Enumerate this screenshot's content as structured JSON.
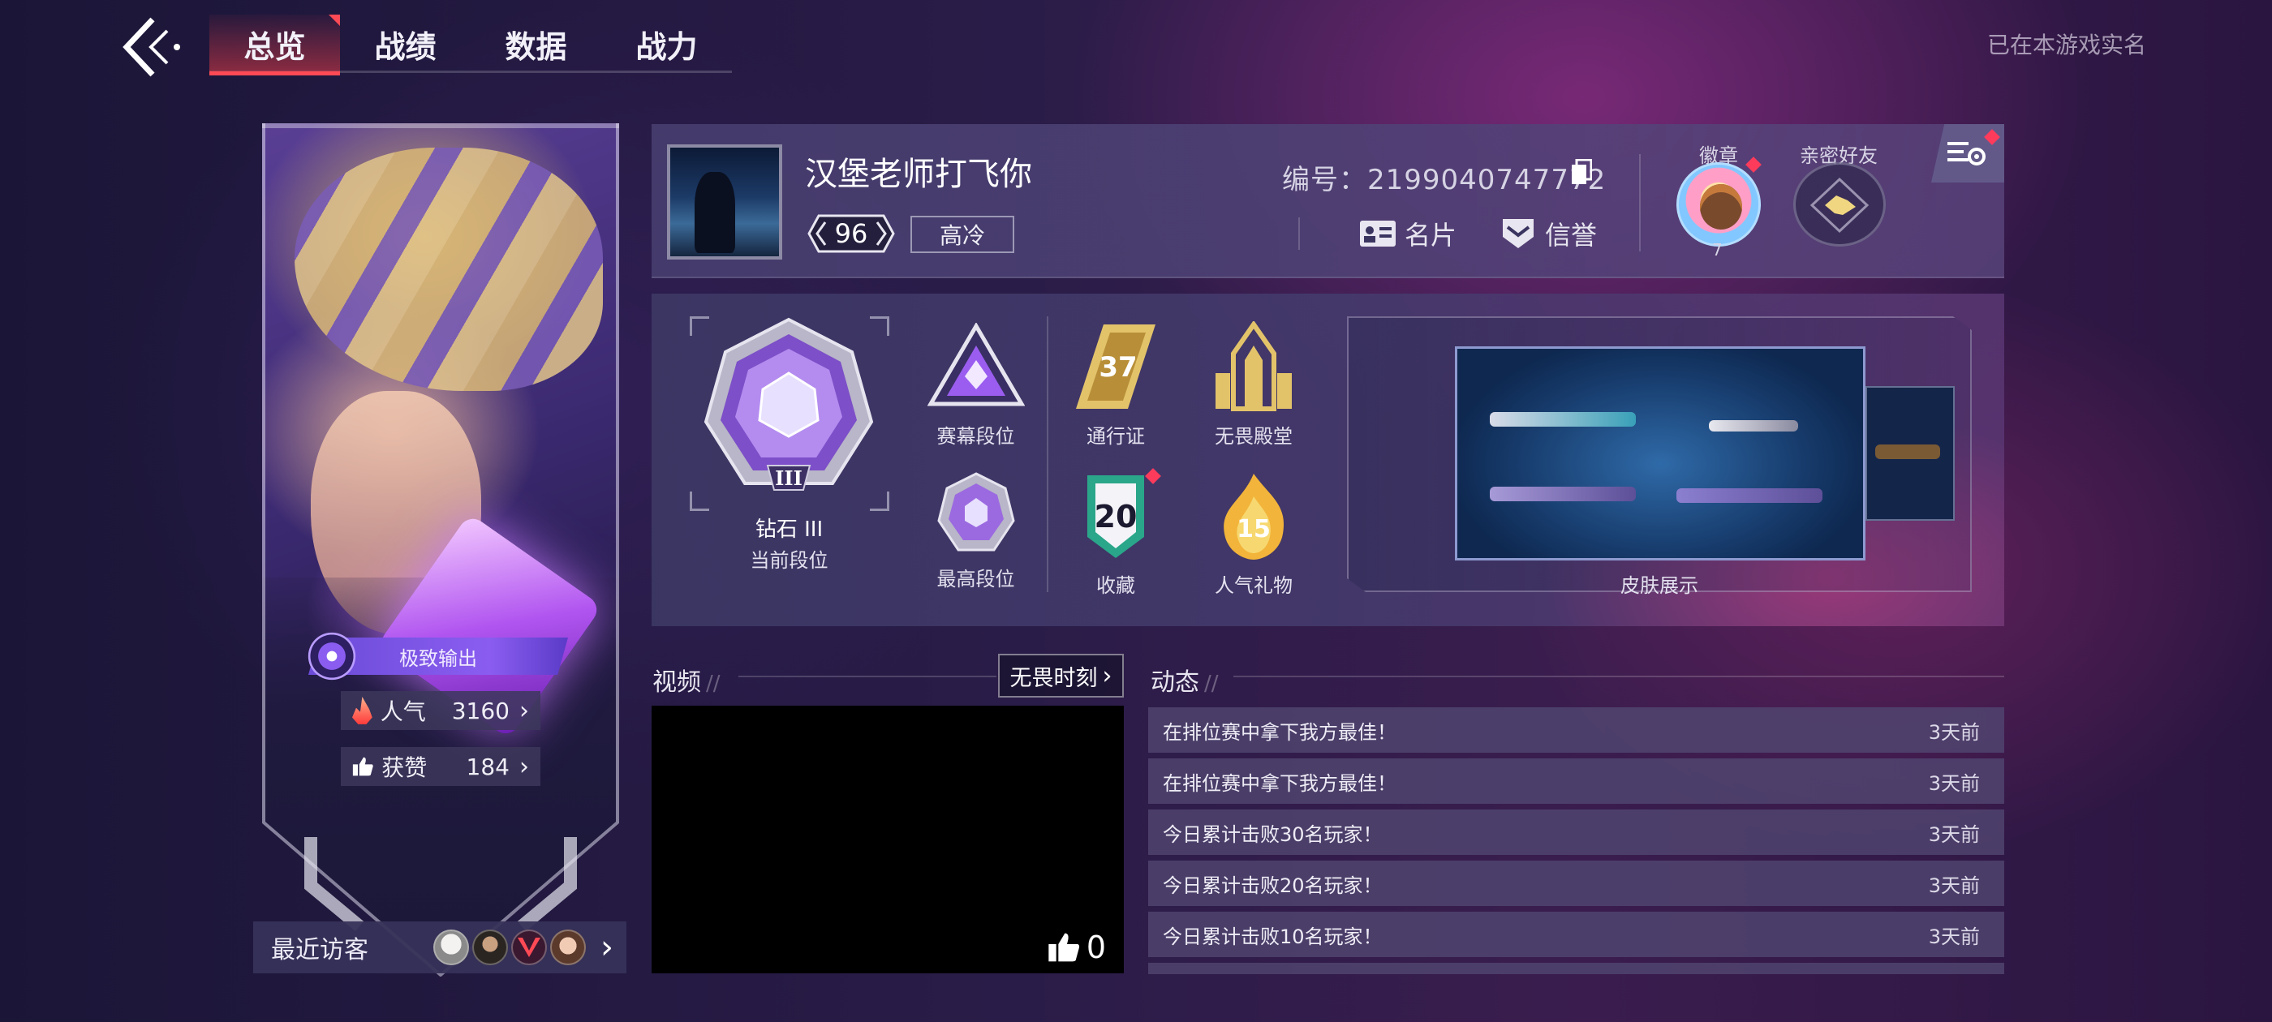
{
  "nav": {
    "tabs": [
      {
        "label": "总览",
        "active": true
      },
      {
        "label": "战绩",
        "active": false
      },
      {
        "label": "数据",
        "active": false
      },
      {
        "label": "战力",
        "active": false
      }
    ],
    "realname_label": "已在本游戏实名"
  },
  "agent_card": {
    "role_label": "极致输出",
    "popularity_label": "人气",
    "popularity_value": "3160",
    "likes_label": "获赞",
    "likes_value": "184",
    "visitors_label": "最近访客"
  },
  "profile": {
    "name": "汉堡老师打飞你",
    "level": "96",
    "title_tag": "高冷",
    "id_text": "编号：2199040747772",
    "card_label": "名片",
    "credit_label": "信誉",
    "badge_label": "徽章",
    "badge_count": "7",
    "friend_label": "亲密好友"
  },
  "rank": {
    "current_rank_name": "钻石 III",
    "current_rank_label": "当前段位",
    "season_rank_label": "赛幕段位",
    "highest_rank_label": "最高段位",
    "battlepass_label": "通行证",
    "battlepass_level": "37",
    "hall_label": "无畏殿堂",
    "collection_label": "收藏",
    "collection_count": "20",
    "gift_label": "人气礼物",
    "gift_count": "15",
    "skin_label": "皮肤展示"
  },
  "video": {
    "section_title": "视频",
    "moment_button": "无畏时刻",
    "likes": "0"
  },
  "feed": {
    "section_title": "动态",
    "items": [
      {
        "text": "在排位赛中拿下我方最佳！",
        "time": "3天前"
      },
      {
        "text": "在排位赛中拿下我方最佳！",
        "time": "3天前"
      },
      {
        "text": "今日累计击败30名玩家！",
        "time": "3天前"
      },
      {
        "text": "今日累计击败20名玩家！",
        "time": "3天前"
      },
      {
        "text": "今日累计击败10名玩家！",
        "time": "3天前"
      }
    ]
  },
  "colors": {
    "accent_red": "#ff4a55",
    "role_purple": "#8a5df0",
    "skin_blue": "#2f6aa8"
  }
}
